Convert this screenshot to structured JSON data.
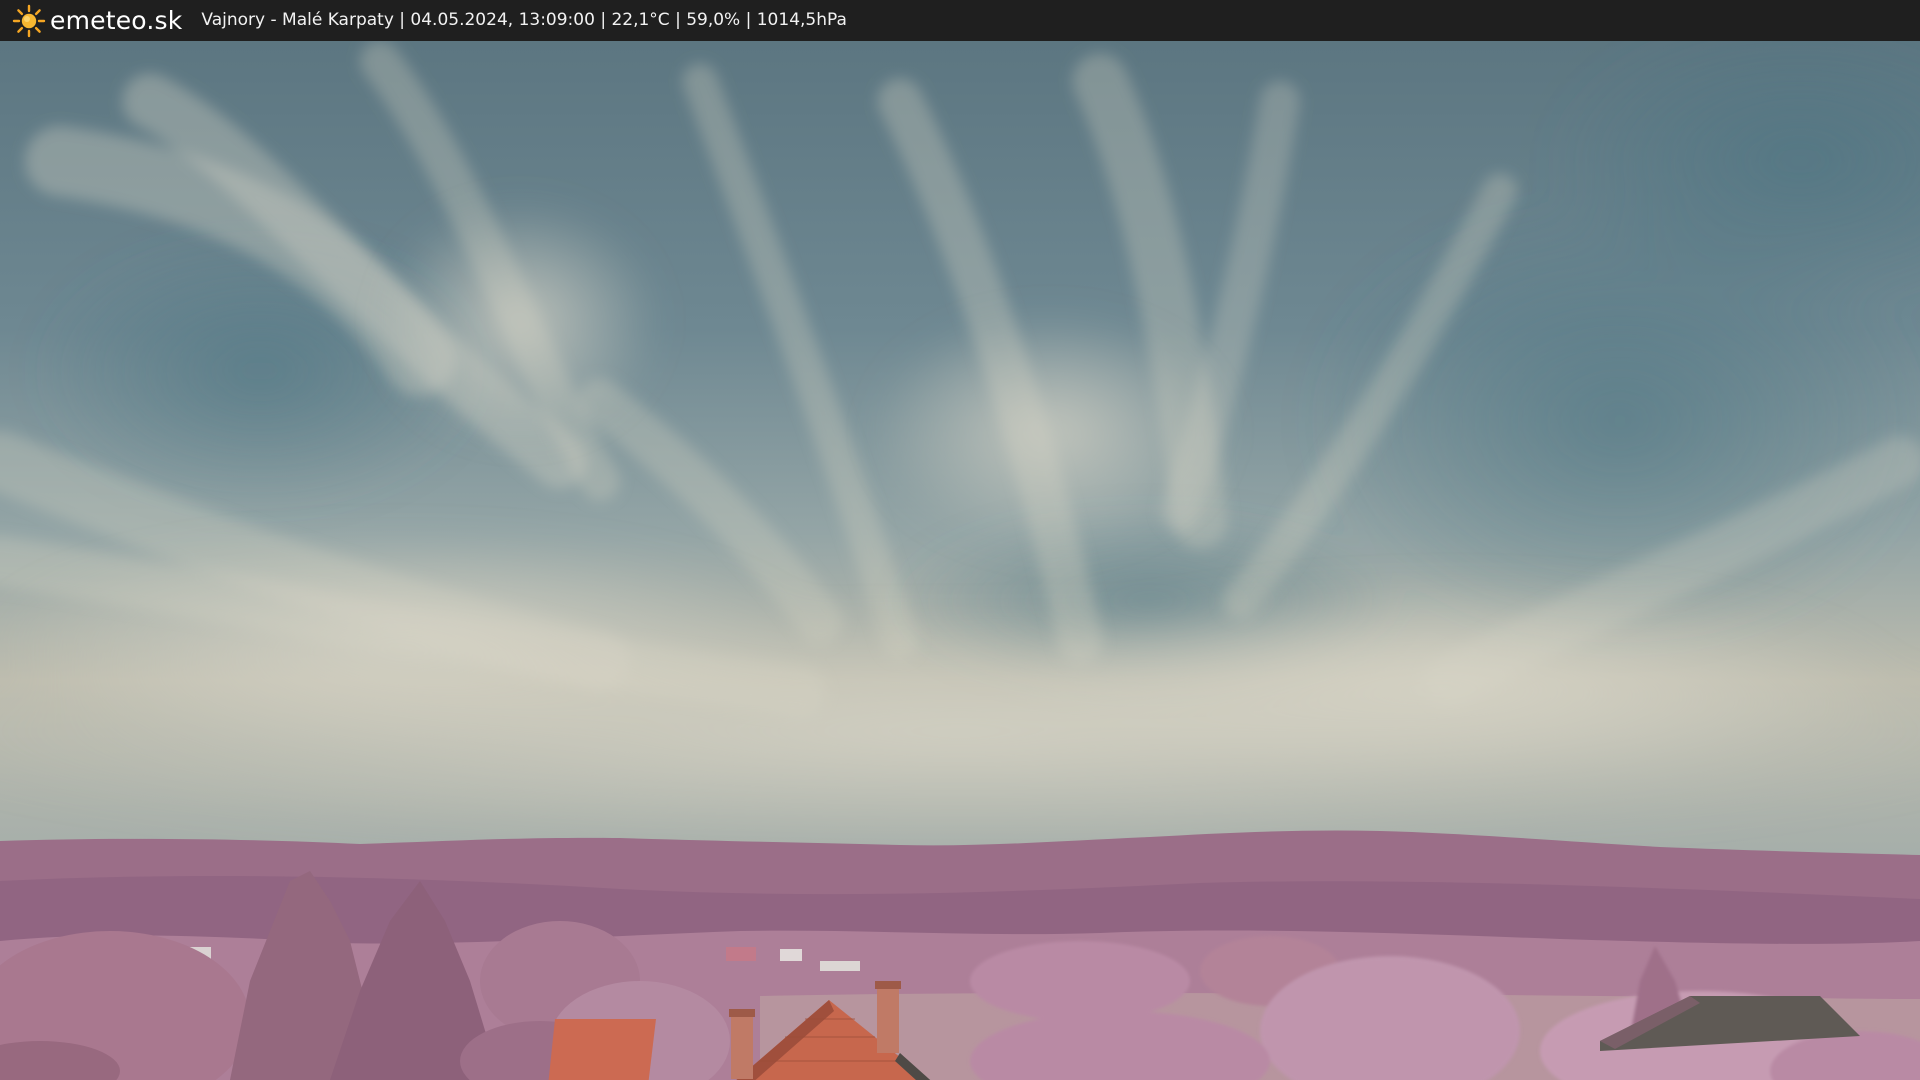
{
  "header": {
    "brand": "emeteo.sk",
    "logo_icon": "sun-icon",
    "caption": "Vajnory - Malé Karpaty | 04.05.2024, 13:09:00 | 22,1°C | 59,0% | 1014,5hPa"
  },
  "colors": {
    "bar": "#1f1f1f",
    "sun": "#f5a623",
    "sky_top": "#5f7b86",
    "sky_horizon": "#c9c4b4",
    "hills": "#9a6d87",
    "foliage": "#b98aa4",
    "roof": "#c7674d"
  }
}
